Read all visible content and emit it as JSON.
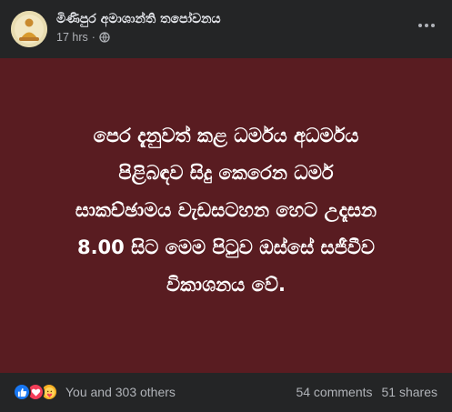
{
  "post": {
    "page_name": "මිණිපුර අමාශාන්ති තපෝවනය",
    "timestamp": "17 hrs",
    "separator": "·",
    "body_lines": [
      "පෙර දැනුවත් කළ ධර්මය අධර්මය",
      "පිළිබඳව සිදු කෙරෙන ධර්ම",
      "සාකච්ඡාමය වැඩසටහන හෙට උදෑසන",
      "8.00 සිට මෙම පිටුව ඔස්සේ සජීවීව",
      "විකාශනය වේ."
    ],
    "body_bg_color": "#591c21"
  },
  "footer": {
    "reactions": [
      "like-icon",
      "love-icon",
      "care-icon"
    ],
    "reaction_text": "You and 303 others",
    "comments": "54 comments",
    "shares": "51 shares"
  }
}
